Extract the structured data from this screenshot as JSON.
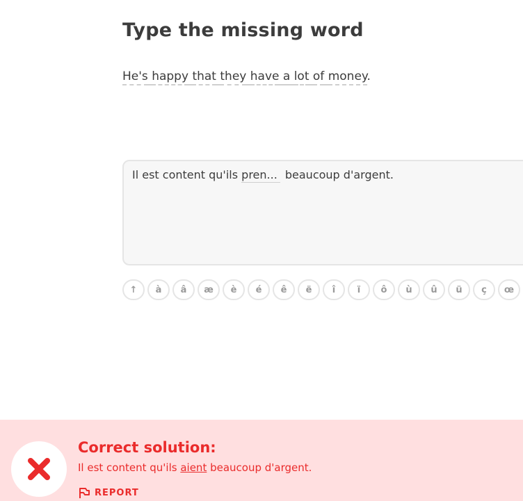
{
  "header": {
    "title": "Type the missing word"
  },
  "prompt": {
    "words": [
      "He's",
      "happy",
      "that",
      "they",
      "have",
      "a",
      "lot",
      "of",
      "money"
    ],
    "punct": "."
  },
  "answer": {
    "before": "Il est content qu'ils",
    "typed": "pren...",
    "after": "beaucoup d'argent."
  },
  "keyboard": {
    "keys": [
      {
        "label": "↑",
        "name": "shift-key"
      },
      {
        "label": "à",
        "name": "key-a-grave"
      },
      {
        "label": "â",
        "name": "key-a-circumflex"
      },
      {
        "label": "æ",
        "name": "key-ae"
      },
      {
        "label": "è",
        "name": "key-e-grave"
      },
      {
        "label": "é",
        "name": "key-e-acute"
      },
      {
        "label": "ê",
        "name": "key-e-circumflex"
      },
      {
        "label": "ë",
        "name": "key-e-diaeresis"
      },
      {
        "label": "î",
        "name": "key-i-circumflex"
      },
      {
        "label": "ï",
        "name": "key-i-diaeresis"
      },
      {
        "label": "ô",
        "name": "key-o-circumflex"
      },
      {
        "label": "ù",
        "name": "key-u-grave"
      },
      {
        "label": "û",
        "name": "key-u-circumflex"
      },
      {
        "label": "ü",
        "name": "key-u-diaeresis"
      },
      {
        "label": "ç",
        "name": "key-c-cedilla"
      },
      {
        "label": "œ",
        "name": "key-oe"
      }
    ]
  },
  "feedback": {
    "title": "Correct solution:",
    "solution_before": "Il est content qu'ils",
    "solution_highlight": "aient",
    "solution_after": "beaucoup d'argent.",
    "report_label": "REPORT",
    "icon": "x-icon",
    "color": "#ea2b2b",
    "background": "#ffdfe0"
  }
}
